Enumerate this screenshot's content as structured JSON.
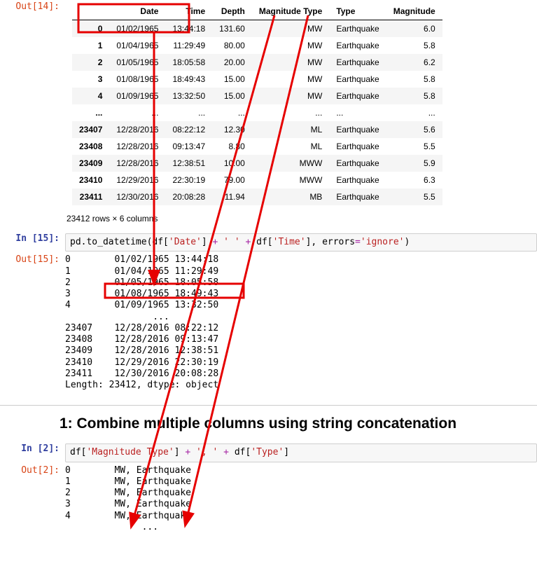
{
  "cell14": {
    "out_prompt": "Out[14]:",
    "headers": [
      "",
      "Date",
      "Time",
      "Depth",
      "Magnitude Type",
      "Type",
      "Magnitude"
    ],
    "rows_top": [
      [
        "0",
        "01/02/1965",
        "13:44:18",
        "131.60",
        "MW",
        "Earthquake",
        "6.0"
      ],
      [
        "1",
        "01/04/1965",
        "11:29:49",
        "80.00",
        "MW",
        "Earthquake",
        "5.8"
      ],
      [
        "2",
        "01/05/1965",
        "18:05:58",
        "20.00",
        "MW",
        "Earthquake",
        "6.2"
      ],
      [
        "3",
        "01/08/1965",
        "18:49:43",
        "15.00",
        "MW",
        "Earthquake",
        "5.8"
      ],
      [
        "4",
        "01/09/1965",
        "13:32:50",
        "15.00",
        "MW",
        "Earthquake",
        "5.8"
      ]
    ],
    "ellipsis_row": [
      "...",
      "...",
      "...",
      "...",
      "...",
      "...",
      "..."
    ],
    "rows_bottom": [
      [
        "23407",
        "12/28/2016",
        "08:22:12",
        "12.30",
        "ML",
        "Earthquake",
        "5.6"
      ],
      [
        "23408",
        "12/28/2016",
        "09:13:47",
        "8.80",
        "ML",
        "Earthquake",
        "5.5"
      ],
      [
        "23409",
        "12/28/2016",
        "12:38:51",
        "10.00",
        "MWW",
        "Earthquake",
        "5.9"
      ],
      [
        "23410",
        "12/29/2016",
        "22:30:19",
        "79.00",
        "MWW",
        "Earthquake",
        "6.3"
      ],
      [
        "23411",
        "12/30/2016",
        "20:08:28",
        "11.94",
        "MB",
        "Earthquake",
        "5.5"
      ]
    ],
    "rowcount": "23412 rows × 6 columns"
  },
  "cell15": {
    "in_prompt": "In [15]:",
    "out_prompt": "Out[15]:",
    "code": {
      "a": "pd.to_datetime(df[",
      "s1": "'Date'",
      "b": "] ",
      "op1": "+",
      "c": " ",
      "s2": "' '",
      "d": " ",
      "op2": "+",
      "e": " df[",
      "s3": "'Time'",
      "f": "], errors",
      "op3": "=",
      "s4": "'ignore'",
      "g": ")"
    },
    "output": "0        01/02/1965 13:44:18\n1        01/04/1965 11:29:49\n2        01/05/1965 18:05:58\n3        01/08/1965 18:49:43\n4        01/09/1965 13:32:50\n                ...         \n23407    12/28/2016 08:22:12\n23408    12/28/2016 09:13:47\n23409    12/28/2016 12:38:51\n23410    12/29/2016 22:30:19\n23411    12/30/2016 20:08:28\nLength: 23412, dtype: object"
  },
  "section1": {
    "title": "1: Combine multiple columns using string concatenation"
  },
  "cell2": {
    "in_prompt": "In [2]:",
    "out_prompt": "Out[2]:",
    "code": {
      "a": "df[",
      "s1": "'Magnitude Type'",
      "b": "] ",
      "op1": "+",
      "c": " ",
      "s2": "', '",
      "d": " ",
      "op2": "+",
      "e": " df[",
      "s3": "'Type'",
      "f": "]"
    },
    "output": "0        MW, Earthquake\n1        MW, Earthquake\n2        MW, Earthquake\n3        MW, Earthquake\n4        MW, Earthquake\n              ...      "
  }
}
